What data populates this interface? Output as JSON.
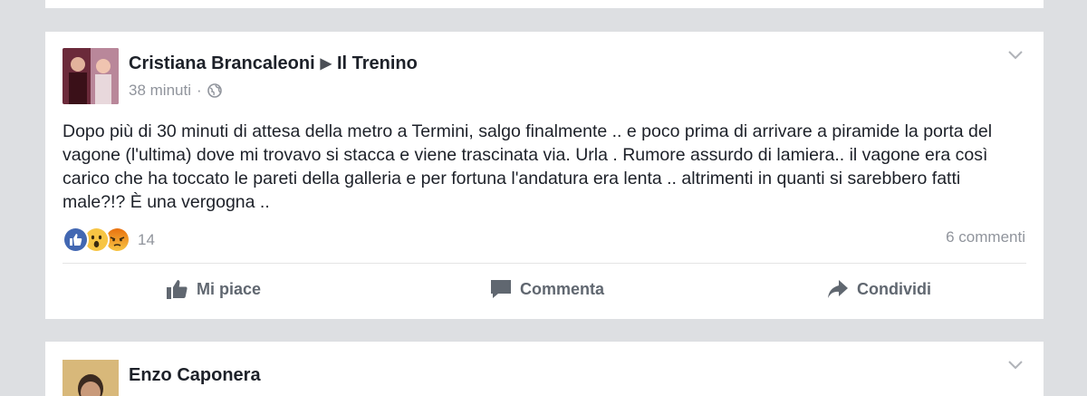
{
  "post": {
    "author": "Cristiana Brancaleoni",
    "group": "Il Trenino",
    "time": "38 minuti",
    "separator": "·",
    "text": "Dopo più di 30 minuti di attesa della metro a Termini, salgo finalmente .. e poco prima di arrivare a piramide la porta del vagone (l'ultima) dove mi trovavo si stacca e viene trascinata via. Urla . Rumore assurdo di lamiera.. il vagone era così carico che ha toccato le pareti della galleria e per fortuna l'andatura era lenta .. altrimenti in quanti si sarebbero fatti male?!? È una vergogna ..",
    "reactions": {
      "icons": [
        "like-icon",
        "wow-icon",
        "angry-icon"
      ],
      "count": "14"
    },
    "comments": "6 commenti",
    "actions": {
      "like": "Mi piace",
      "comment": "Commenta",
      "share": "Condividi"
    }
  },
  "next_post": {
    "author": "Enzo Caponera"
  },
  "colors": {
    "background": "#dddfe2",
    "like_blue": "#4267b2",
    "wow_yellow": "#f7c544",
    "angry_orange": "#e9710f",
    "muted_text": "#90949c"
  }
}
